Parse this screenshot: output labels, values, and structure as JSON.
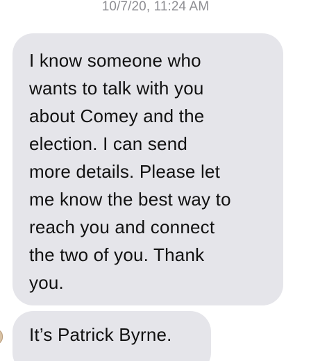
{
  "conversation": {
    "timestamp": "10/7/20, 11:24 AM",
    "messages": [
      {
        "text": "I know someone who\nwants to talk with you\nabout Comey and the\nelection.  I can send\nmore details.  Please let\nme know the best way to\nreach you and connect\nthe two of you.  Thank\nyou."
      },
      {
        "text": "It’s Patrick Byrne."
      }
    ]
  }
}
